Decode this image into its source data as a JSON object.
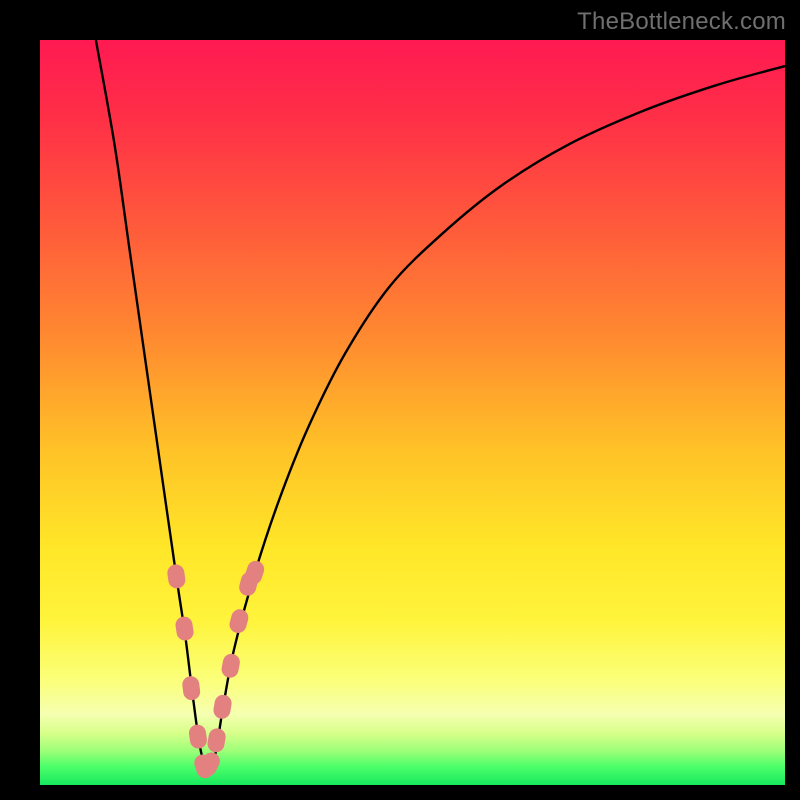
{
  "watermark": "TheBottleneck.com",
  "gradient_stops": [
    {
      "offset": 0.0,
      "color": "#ff1a52"
    },
    {
      "offset": 0.1,
      "color": "#ff2e47"
    },
    {
      "offset": 0.25,
      "color": "#ff5a3b"
    },
    {
      "offset": 0.4,
      "color": "#ff8a30"
    },
    {
      "offset": 0.55,
      "color": "#ffc227"
    },
    {
      "offset": 0.68,
      "color": "#ffe628"
    },
    {
      "offset": 0.78,
      "color": "#fff43c"
    },
    {
      "offset": 0.86,
      "color": "#fbff7a"
    },
    {
      "offset": 0.905,
      "color": "#f5ffb0"
    },
    {
      "offset": 0.93,
      "color": "#d8ff8a"
    },
    {
      "offset": 0.955,
      "color": "#9bff78"
    },
    {
      "offset": 0.975,
      "color": "#4dff6a"
    },
    {
      "offset": 1.0,
      "color": "#17e85e"
    }
  ],
  "curve_color": "#000000",
  "marker_color": "#e38181",
  "chart_data": {
    "type": "line",
    "title": "",
    "xlabel": "",
    "ylabel": "",
    "xlim": [
      0,
      100
    ],
    "ylim": [
      0,
      100
    ],
    "note": "V-shaped bottleneck curve. x is an abstract horizontal position (percent of plot width), y is bottleneck severity (percent, 0 at bottom = no bottleneck, 100 at top). Minimum near x≈22.",
    "series": [
      {
        "name": "bottleneck-curve",
        "x": [
          7.5,
          10,
          12,
          14,
          16,
          18.3,
          19.5,
          20.5,
          21.5,
          22.5,
          23.5,
          24.5,
          26,
          28.7,
          32,
          36,
          41,
          47,
          54,
          62,
          71,
          81,
          91,
          100
        ],
        "y": [
          100,
          86,
          72,
          58,
          44,
          28,
          20,
          12,
          5,
          2,
          4,
          10,
          18,
          28,
          38,
          48,
          58,
          67,
          74,
          80.5,
          86,
          90.5,
          94,
          96.5
        ]
      }
    ],
    "markers": {
      "name": "highlighted-points",
      "note": "Pink capsule markers clustered around the valley of the curve.",
      "x": [
        18.3,
        19.4,
        20.3,
        21.2,
        22.0,
        22.8,
        23.7,
        24.5,
        25.6,
        26.7,
        28.0,
        28.8
      ],
      "y": [
        28.0,
        21.0,
        13.0,
        6.5,
        2.5,
        2.8,
        6.0,
        10.5,
        16.0,
        22.0,
        27.0,
        28.5
      ]
    }
  }
}
